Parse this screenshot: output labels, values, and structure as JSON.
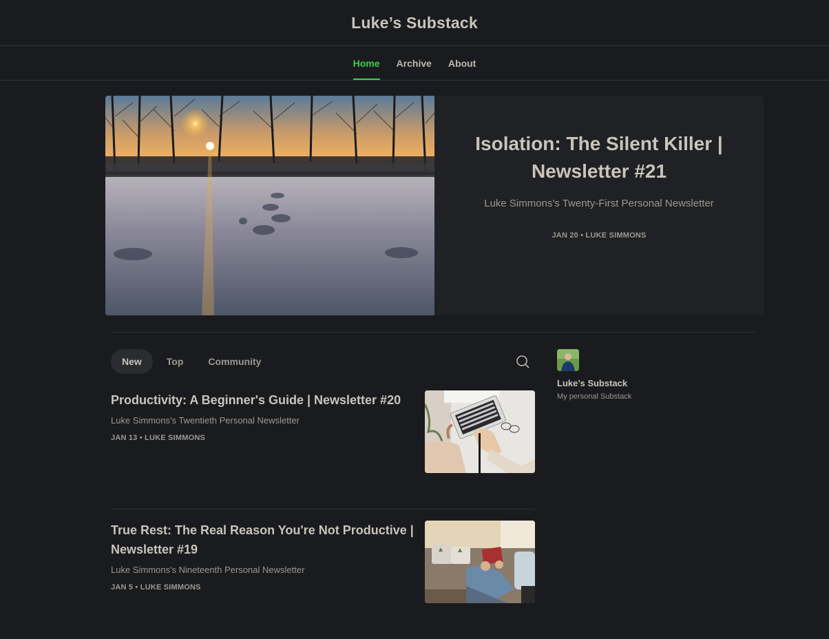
{
  "header": {
    "title": "Luke’s Substack"
  },
  "nav": {
    "items": [
      {
        "label": "Home",
        "active": true
      },
      {
        "label": "Archive",
        "active": false
      },
      {
        "label": "About",
        "active": false
      }
    ]
  },
  "featured": {
    "title": "Isolation: The Silent Killer | Newsletter #21",
    "subtitle": "Luke Simmons's Twenty-First Personal Newsletter",
    "meta": "JAN 20 • LUKE SIMMONS"
  },
  "feed_tabs": [
    "New",
    "Top",
    "Community"
  ],
  "posts": [
    {
      "title": "Productivity: A Beginner's Guide | Newsletter #20",
      "subtitle": "Luke Simmons's Twentieth Personal Newsletter",
      "meta": "JAN 13 • LUKE SIMMONS"
    },
    {
      "title": "True Rest: The Real Reason You're Not Productive | Newsletter #19",
      "subtitle": "Luke Simmons's Nineteenth Personal Newsletter",
      "meta": "JAN 5 • LUKE SIMMONS"
    }
  ],
  "sidebar": {
    "name": "Luke’s Substack",
    "description": "My personal Substack"
  },
  "colors": {
    "background": "#1a1b1e",
    "accent": "#3ecf4c",
    "text": "#c9c4bc",
    "muted": "#9d9890"
  },
  "icons": {
    "search": "search-icon"
  }
}
